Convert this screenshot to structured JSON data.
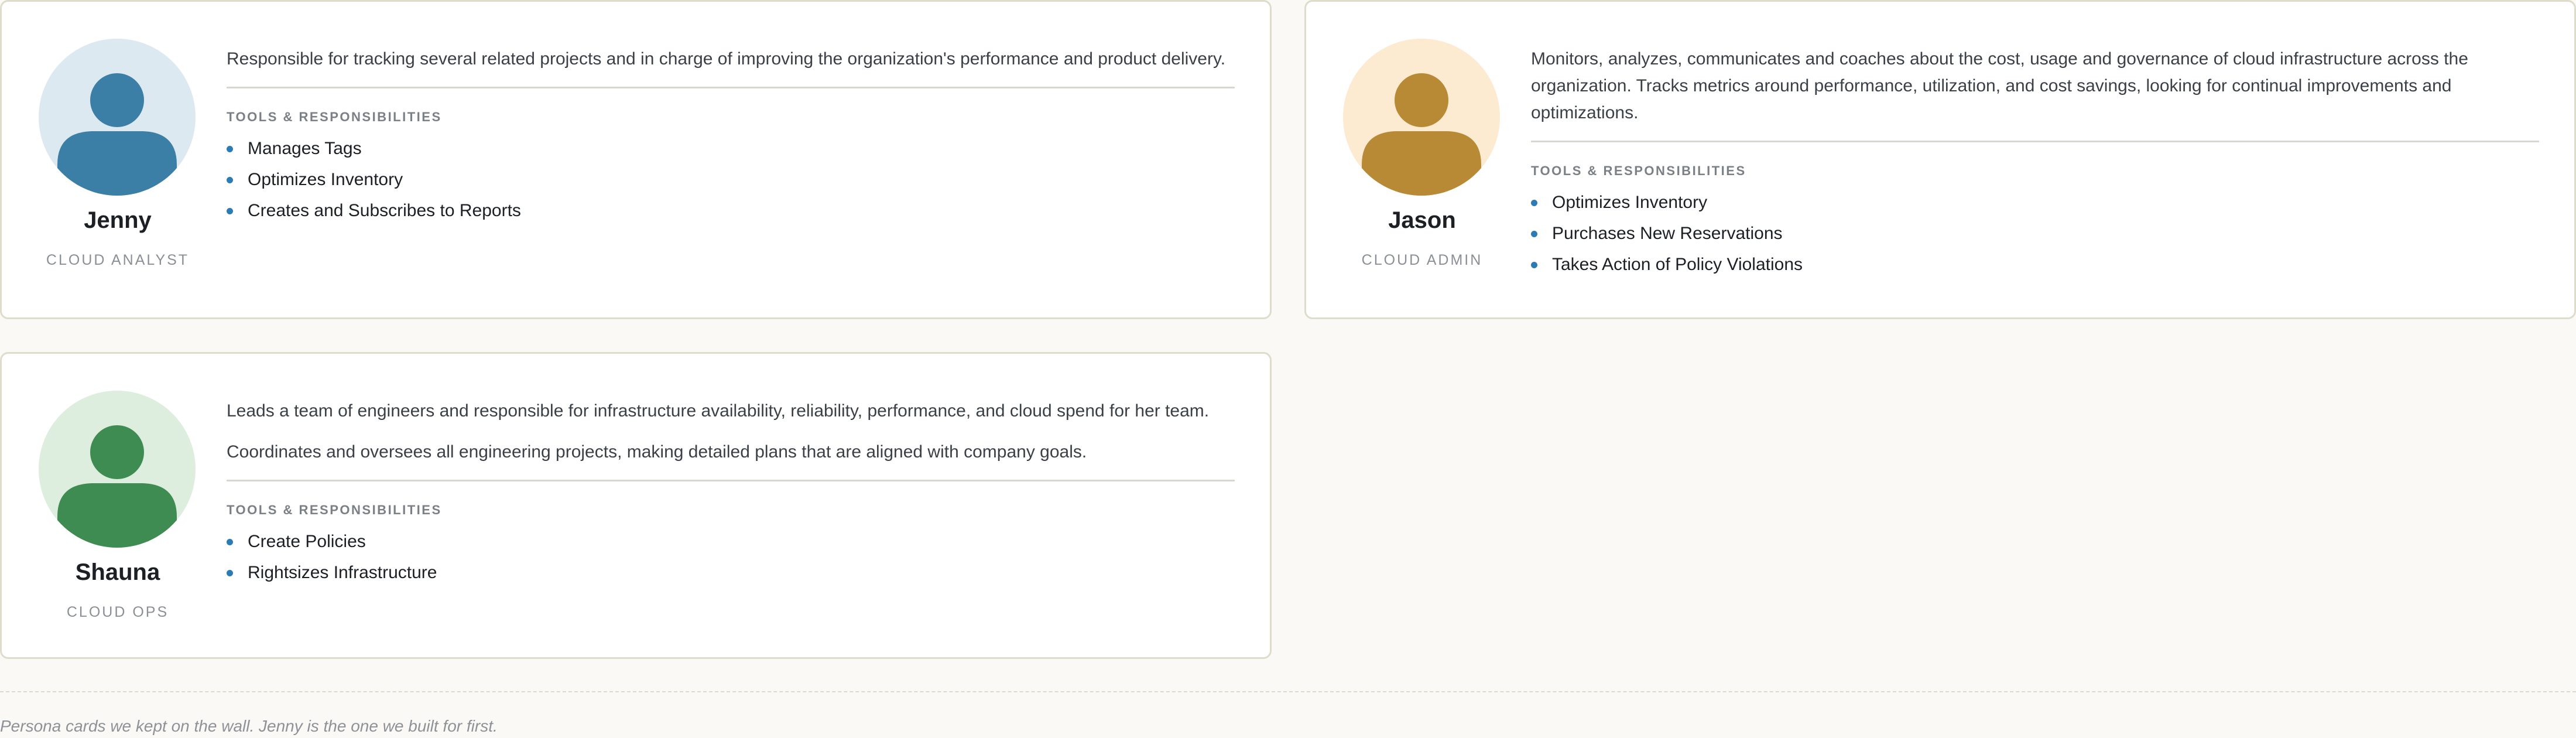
{
  "personas": [
    {
      "name": "Jenny",
      "role": "CLOUD ANALYST",
      "avatar_icon": "person-icon",
      "avatar_bg": "#dde9f0",
      "avatar_fg": "#3b7fa6",
      "descriptions": [
        "Responsible for tracking several related projects and in charge of improving the organization's performance and product delivery."
      ],
      "section_title": "TOOLS & RESPONSIBILITIES",
      "responsibilities": [
        "Manages Tags",
        "Optimizes Inventory",
        "Creates and Subscribes to Reports"
      ]
    },
    {
      "name": "Jason",
      "role": "CLOUD ADMIN",
      "avatar_icon": "person-icon",
      "avatar_bg": "#fcebd0",
      "avatar_fg": "#b98a35",
      "descriptions": [
        "Monitors, analyzes, communicates and coaches about the cost, usage and governance of cloud infrastructure across the organization. Tracks metrics around performance, utilization, and cost savings, looking for continual improvements and optimizations."
      ],
      "section_title": "TOOLS & RESPONSIBILITIES",
      "responsibilities": [
        "Optimizes Inventory",
        "Purchases New Reservations",
        "Takes Action of Policy Violations"
      ]
    },
    {
      "name": "Shauna",
      "role": "CLOUD OPS",
      "avatar_icon": "person-icon",
      "avatar_bg": "#ddeedf",
      "avatar_fg": "#3f8c52",
      "descriptions": [
        "Leads a team of engineers and responsible for infrastructure availability, reliability, performance, and cloud spend for her team.",
        "Coordinates and oversees all engineering projects, making detailed plans that are aligned with company goals."
      ],
      "section_title": "TOOLS & RESPONSIBILITIES",
      "responsibilities": [
        "Create Policies",
        "Rightsizes Infrastructure"
      ]
    }
  ],
  "bullet_color": "#2b7bb5",
  "caption": "Persona cards we kept on the wall. Jenny is the one we built for first."
}
